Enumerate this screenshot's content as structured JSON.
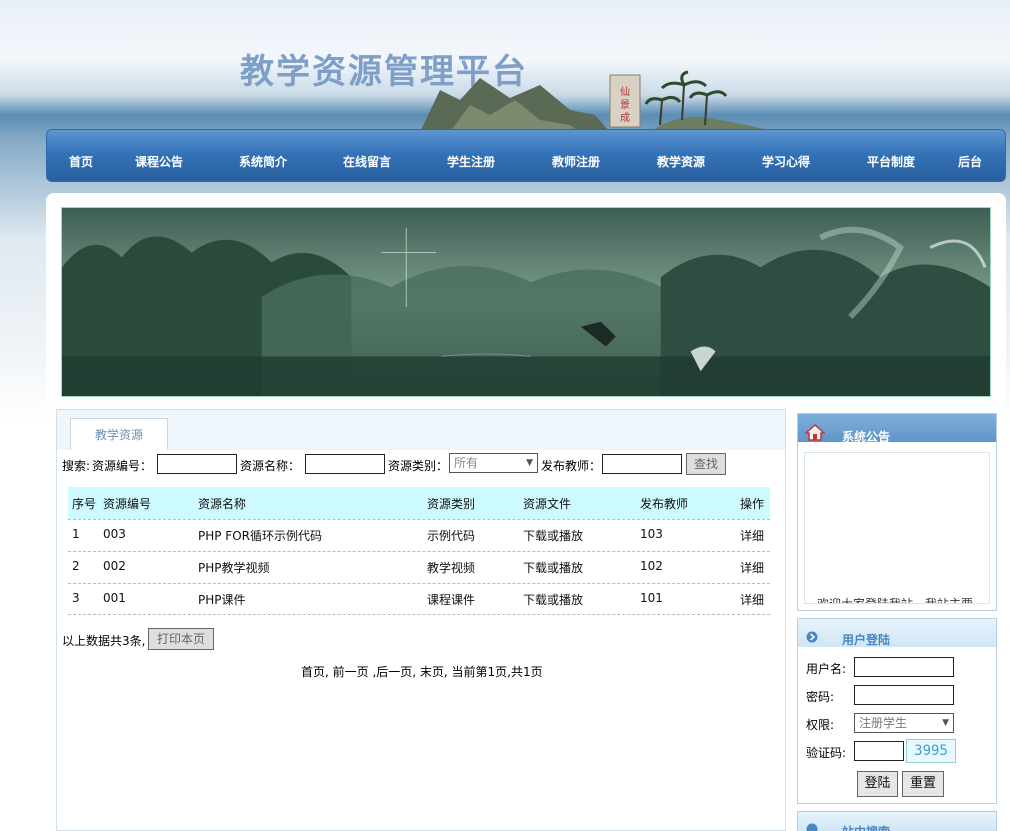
{
  "header": {
    "title": "教学资源管理平台"
  },
  "nav": [
    "首页",
    "课程公告",
    "系统简介",
    "在线留言",
    "学生注册",
    "教师注册",
    "教学资源",
    "学习心得",
    "平台制度",
    "后台"
  ],
  "main": {
    "tab_label": "教学资源",
    "search": {
      "prefix": "搜索:",
      "code_label": "资源编号：",
      "name_label": "资源名称：",
      "type_label": "资源类别：",
      "type_selected": "所有",
      "teacher_label": "发布教师：",
      "button": "查找"
    },
    "table": {
      "headers": [
        "序号",
        "资源编号",
        "资源名称",
        "资源类别",
        "资源文件",
        "发布教师",
        "操作"
      ],
      "rows": [
        [
          "1",
          "003",
          "PHP FOR循环示例代码",
          "示例代码",
          "下载或播放",
          "103",
          "详细"
        ],
        [
          "2",
          "002",
          "PHP教学视频",
          "教学视频",
          "下载或播放",
          "102",
          "详细"
        ],
        [
          "3",
          "001",
          "PHP课件",
          "课程课件",
          "下载或播放",
          "101",
          "详细"
        ]
      ]
    },
    "summary": "以上数据共3条,",
    "print_button": "打印本页",
    "pager": "首页, 前一页 ,后一页, 末页, 当前第1页,共1页"
  },
  "sidebar": {
    "notice_title": "系统公告",
    "notice_scroll_text": "欢迎大家登陆我站，我站主要",
    "login_title": "用户登陆",
    "username_label": "用户名:",
    "password_label": "密码:",
    "role_label": "权限:",
    "role_selected": "注册学生",
    "captcha_label": "验证码:",
    "captcha_value": "3995",
    "login_button": "登陆",
    "reset_button": "重置",
    "search_title": "站内搜索"
  },
  "colors": {
    "nav_blue": "#3473b8",
    "table_header": "#ccfaff",
    "accent_blue": "#4a86c2"
  }
}
